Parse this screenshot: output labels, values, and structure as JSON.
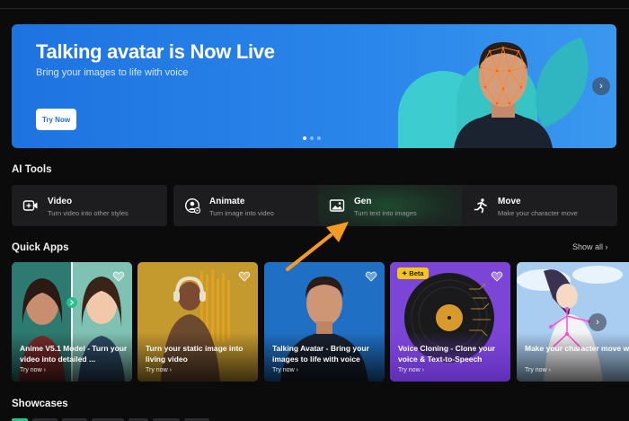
{
  "hero": {
    "title": "Talking avatar is Now Live",
    "subtitle": "Bring your images to life with voice",
    "button": "Try Now",
    "next": "›"
  },
  "sections": {
    "ai_tools": "AI Tools",
    "quick_apps": "Quick Apps",
    "showcases": "Showcases",
    "show_all": "Show all  ›"
  },
  "tools": [
    {
      "name": "Video",
      "desc": "Turn video into other styles",
      "icon": "video-icon"
    },
    {
      "name": "Animate",
      "desc": "Turn image into video",
      "icon": "animate-icon"
    },
    {
      "name": "Gen",
      "desc": "Turn text into images",
      "icon": "image-icon"
    },
    {
      "name": "Move",
      "desc": "Make your character move",
      "icon": "running-icon"
    }
  ],
  "apps": [
    {
      "title": "Anime V5.1 Model - Turn your video into detailed ...",
      "try": "Try now  ›"
    },
    {
      "title": "Turn your static image into living video",
      "try": "Try now  ›"
    },
    {
      "title": "Talking Avatar - Bring your images to life with voice",
      "try": "Try now  ›"
    },
    {
      "title": "Voice Cloning - Clone your voice & Text-to-Speech",
      "try": "Try now  ›",
      "badge": "Beta"
    },
    {
      "title": "Make your character move with reference video",
      "try": "Try now  ›"
    }
  ],
  "colors": {
    "accent_blue": "#1e73e0",
    "arrow_orange": "#f59a23",
    "badge_yellow": "#f5c518"
  }
}
